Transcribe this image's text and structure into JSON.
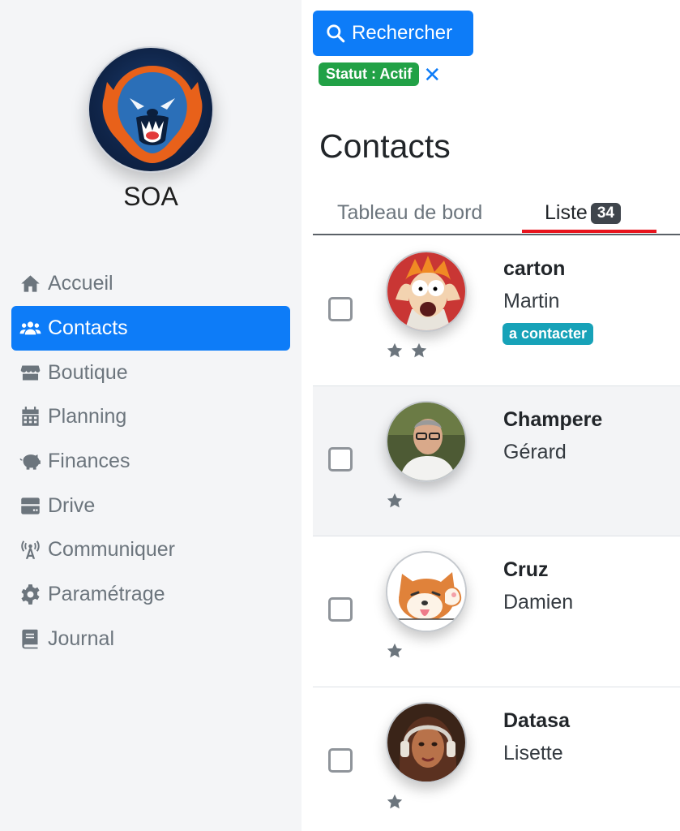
{
  "organization": {
    "name": "SOA",
    "logo_icon": "bear-logo-icon"
  },
  "sidebar": {
    "active_color": "#0d7cf8",
    "items": [
      {
        "label": "Accueil",
        "icon": "home-icon",
        "active": false
      },
      {
        "label": "Contacts",
        "icon": "users-icon",
        "active": true
      },
      {
        "label": "Boutique",
        "icon": "store-icon",
        "active": false
      },
      {
        "label": "Planning",
        "icon": "calendar-icon",
        "active": false
      },
      {
        "label": "Finances",
        "icon": "piggy-bank-icon",
        "active": false
      },
      {
        "label": "Drive",
        "icon": "server-icon",
        "active": false
      },
      {
        "label": "Communiquer",
        "icon": "broadcast-tower-icon",
        "active": false
      },
      {
        "label": "Paramétrage",
        "icon": "gear-icon",
        "active": false
      },
      {
        "label": "Journal",
        "icon": "book-icon",
        "active": false
      }
    ]
  },
  "search": {
    "label": "Rechercher",
    "icon": "search-icon"
  },
  "filter": {
    "label": "Statut : Actif",
    "close_glyph": "✕",
    "color": "#21a146"
  },
  "page": {
    "title": "Contacts"
  },
  "tabs": [
    {
      "label": "Tableau de bord",
      "active": false
    },
    {
      "label": "Liste",
      "count": "34",
      "active": true
    }
  ],
  "contacts": [
    {
      "last_name": "carton",
      "first_name": "Martin",
      "tag": "a contacter",
      "stars": 2,
      "avatar": "cartoon-face-avatar"
    },
    {
      "last_name": "Champere",
      "first_name": "Gérard",
      "tag": "",
      "stars": 1,
      "avatar": "man-photo-avatar"
    },
    {
      "last_name": "Cruz",
      "first_name": "Damien",
      "tag": "",
      "stars": 1,
      "avatar": "shiba-dog-avatar"
    },
    {
      "last_name": "Datasa",
      "first_name": "Lisette",
      "tag": "",
      "stars": 1,
      "avatar": "woman-headphones-avatar"
    }
  ]
}
